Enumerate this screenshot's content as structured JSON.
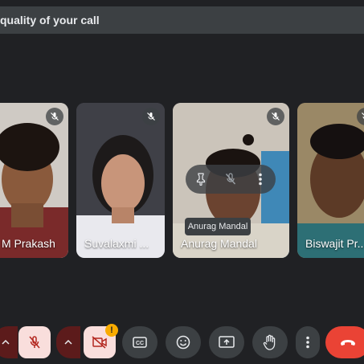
{
  "banner": {
    "text": "quality of your call"
  },
  "participants": [
    {
      "name": "M Prakash",
      "mic_muted": true
    },
    {
      "name": "Suvalaxmi ...",
      "mic_muted": true
    },
    {
      "name": "Anurag Mandal",
      "mic_muted": true,
      "hovered": true
    },
    {
      "name": "Biswajit Pr...",
      "mic_muted": true
    }
  ],
  "tooltip": {
    "text": "Anurag Mandal"
  },
  "tile_actions": [
    "pin-icon",
    "mute-icon",
    "more-vert-icon"
  ],
  "toolbar": {
    "buttons": [
      "mic-options",
      "mic-toggle",
      "camera-options",
      "camera-toggle",
      "captions",
      "emoji",
      "present",
      "raise-hand",
      "more-options",
      "leave-call"
    ],
    "camera_warning_badge": "!"
  },
  "colors": {
    "background": "#202124",
    "muted_button_bg": "#f9dedc",
    "muted_icon": "#b3261e",
    "leave_button": "#ea4335",
    "warning_badge": "#f9ab00"
  }
}
